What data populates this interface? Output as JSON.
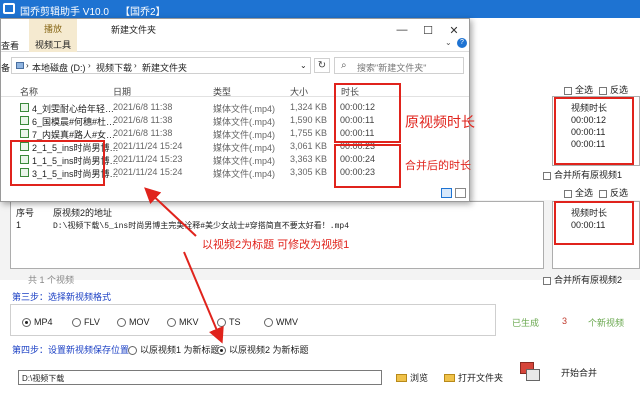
{
  "app": {
    "title": "国乔剪辑助手 V10.0",
    "subtitle": "【国乔2】"
  },
  "explorer": {
    "ribbon_tool": "播放",
    "folder_title": "新建文件夹",
    "tab_view": "查看",
    "tab_video_tools": "视频工具",
    "left_stub": "备",
    "breadcrumbs": [
      "本地磁盘 (D:)",
      "视频下载",
      "新建文件夹"
    ],
    "search_placeholder": "搜索\"新建文件夹\"",
    "columns": {
      "name": "名称",
      "date": "日期",
      "type": "类型",
      "size": "大小",
      "duration": "时长"
    },
    "files": [
      {
        "name": "4_刘雯耐心给年轻…",
        "date": "2021/6/8 11:38",
        "type": "媒体文件(.mp4)",
        "size": "1,324 KB",
        "duration": "00:00:12"
      },
      {
        "name": "6_国模晨#何穗#杜…",
        "date": "2021/6/8 11:38",
        "type": "媒体文件(.mp4)",
        "size": "1,590 KB",
        "duration": "00:00:11"
      },
      {
        "name": "7_内娱真#路人#女…",
        "date": "2021/6/8 11:38",
        "type": "媒体文件(.mp4)",
        "size": "1,755 KB",
        "duration": "00:00:11"
      },
      {
        "name": "2_1_5_ins时尚男博…",
        "date": "2021/11/24 15:24",
        "type": "媒体文件(.mp4)",
        "size": "3,061 KB",
        "duration": "00:00:23"
      },
      {
        "name": "1_1_5_ins时尚男博…",
        "date": "2021/11/24 15:23",
        "type": "媒体文件(.mp4)",
        "size": "3,363 KB",
        "duration": "00:00:24"
      },
      {
        "name": "3_1_5_ins时尚男博…",
        "date": "2021/11/24 15:24",
        "type": "媒体文件(.mp4)",
        "size": "3,305 KB",
        "duration": "00:00:23"
      }
    ]
  },
  "annotations": {
    "original_duration": "原视频时长",
    "merged_duration": "合并后的时长",
    "title_note": "以视频2为标题 可修改为视频1"
  },
  "panel1": {
    "select_all": "全选",
    "invert": "反选",
    "header": "视频时长",
    "durations": [
      "00:00:12",
      "00:00:11",
      "00:00:11"
    ],
    "merge_all": "合并所有原视频1"
  },
  "panel2": {
    "select_all": "全选",
    "invert": "反选",
    "header": "视频时长",
    "durations": [
      "00:00:11"
    ],
    "merge_all": "合并所有原视频2",
    "col_index": "序号",
    "col_path": "原视频2的地址",
    "row_index": "1",
    "row_path": "D:\\视频下载\\5_ins时尚男博主完美诠释#美少女战士#穿搭简直不要太好看！.mp4",
    "count": "共 1 个视频"
  },
  "step3": {
    "label": "第三步：选择新视频格式",
    "formats": [
      "MP4",
      "FLV",
      "MOV",
      "MKV",
      "TS",
      "WMV"
    ],
    "selected": "MP4",
    "generated_prefix": "已生成",
    "generated_count": "3",
    "generated_suffix": "个新视频"
  },
  "step4": {
    "label": "第四步：设置新视频保存位置",
    "opt1": "以原视频1 为新标题",
    "opt2": "以原视频2 为新标题",
    "selected": "opt2",
    "path": "D:\\视频下载",
    "browse": "浏览",
    "open_folder": "打开文件夹",
    "start_merge": "开始合并"
  },
  "colors": {
    "accent_red": "#e0231c",
    "step_blue": "#1a3fc4",
    "titlebar_blue": "#1e73d2"
  }
}
